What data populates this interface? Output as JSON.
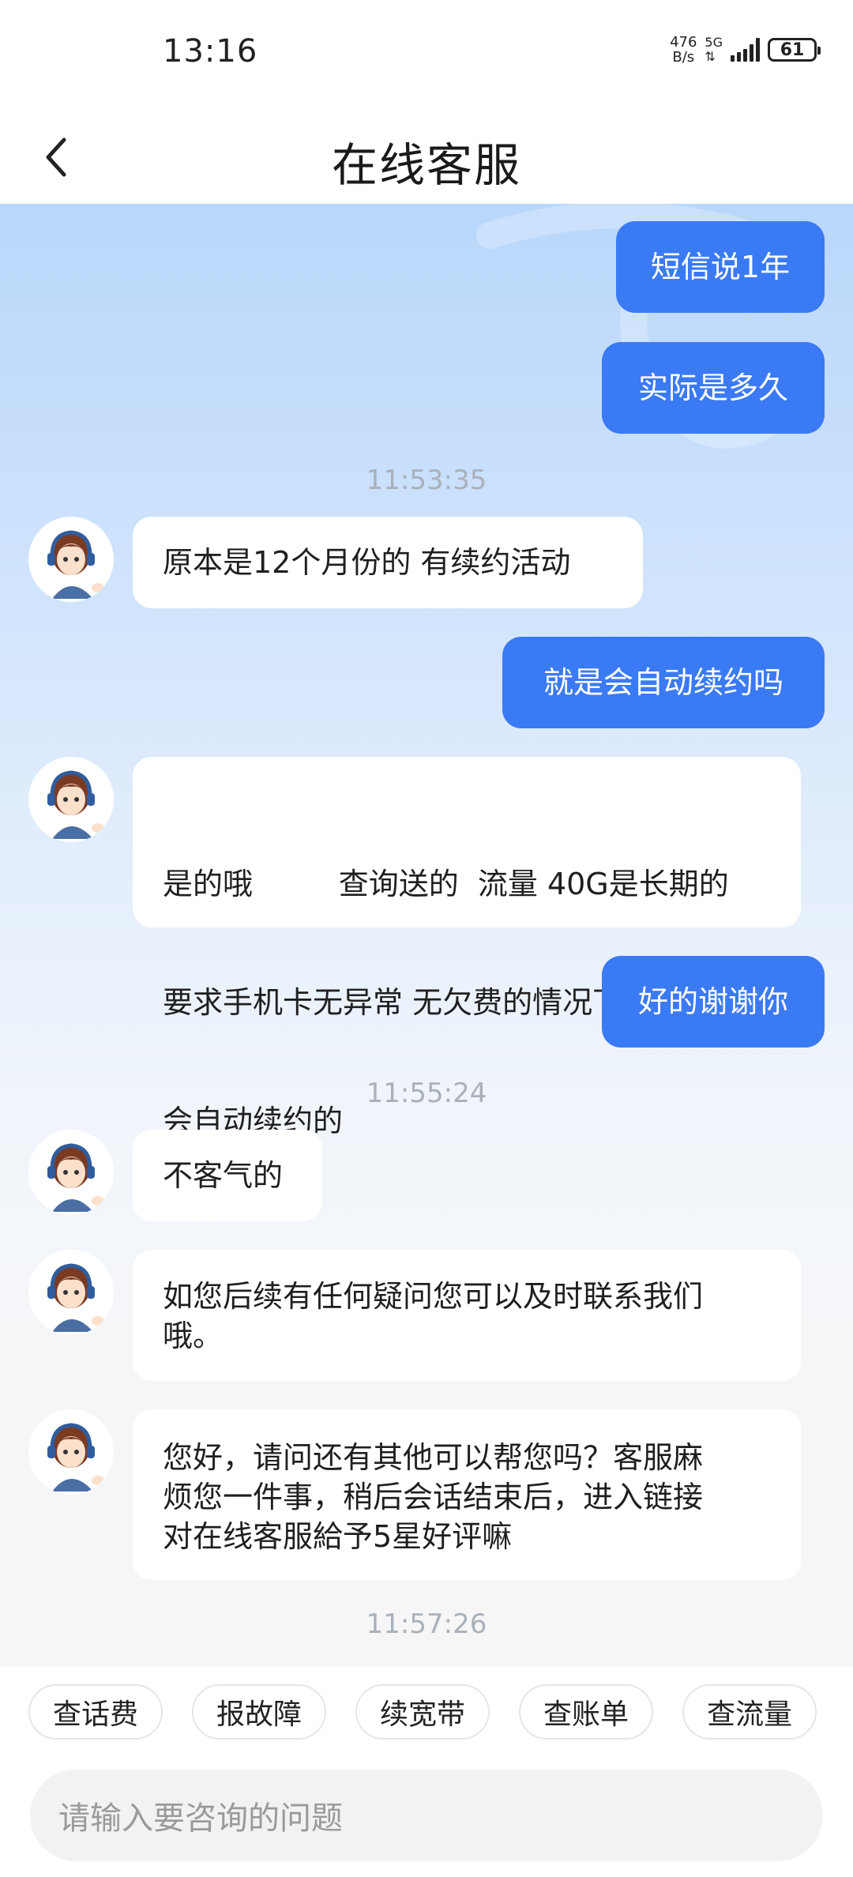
{
  "status": {
    "time": "13:16",
    "net_speed_top": "476",
    "net_speed_bottom": "B/s",
    "net_type_top": "5G",
    "net_type_bottom": "⇅",
    "battery": "61"
  },
  "header": {
    "title": "在线客服"
  },
  "messages": {
    "m1": "短信说1年",
    "m2": "实际是多久",
    "t1": "11:53:35",
    "m3": "原本是12个月份的 有续约活动",
    "m4": "就是会自动续约吗",
    "m5_l1": "是的哦         查询送的  流量 40G是长期的",
    "m5_l2": "要求手机卡无异常 无欠费的情况下 系统",
    "m5_l3": "会自动续约的",
    "m6": "好的谢谢你",
    "t2": "11:55:24",
    "m7": "不客气的",
    "m8_l1": "如您后续有任何疑问您可以及时联系我们",
    "m8_l2": "哦。",
    "m9_l1": "您好，请问还有其他可以帮您吗？客服麻",
    "m9_l2": "烦您一件事，稍后会话结束后，进入链接",
    "m9_l3": "对在线客服給予5星好评嘛",
    "t3": "11:57:26"
  },
  "quick_actions": {
    "a1": "查话费",
    "a2": "报故障",
    "a3": "续宽带",
    "a4": "查账单",
    "a5": "查流量"
  },
  "input": {
    "placeholder": "请输入要咨询的问题"
  },
  "colors": {
    "user_bubble": "#3b7af5",
    "agent_bubble": "#ffffff",
    "chat_bg_top": "#b9d7fb",
    "timestamp": "#a9b0ba"
  }
}
